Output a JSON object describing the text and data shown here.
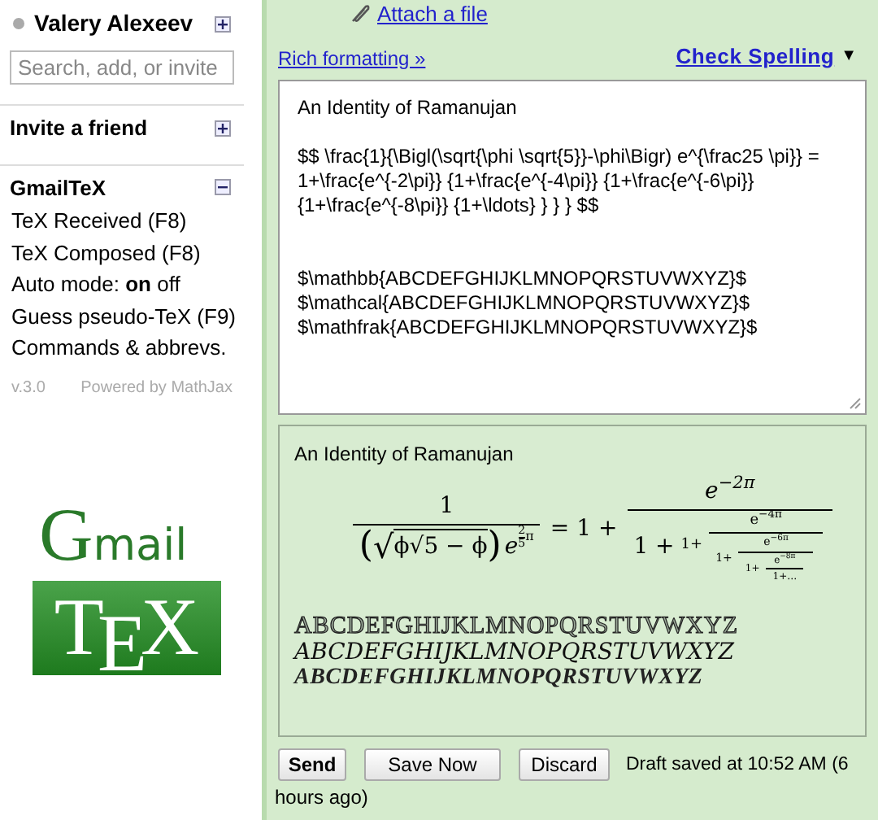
{
  "sidebar": {
    "contact": {
      "name": "Valery Alexeev",
      "online": false
    },
    "search": {
      "placeholder": "Search, add, or invite"
    },
    "sections": [
      {
        "title": "Invite a friend",
        "expanded": false
      },
      {
        "title": "GmailTeX",
        "expanded": true,
        "items": [
          "TeX Received (F8)",
          "TeX Composed (F8)",
          "Auto mode: **on** off",
          "Guess pseudo-TeX (F9)",
          "Commands & abbrevs."
        ]
      }
    ],
    "version": "v.3.0",
    "powered": "Powered by MathJax",
    "logo": {
      "top": "Gmail",
      "bottom": "TEX"
    }
  },
  "compose": {
    "attach": "Attach a file",
    "rich_formatting": "Rich formatting »",
    "check_spelling": "Check Spelling",
    "check_spelling_caret": "▼",
    "body_paragraphs": [
      [
        "An Identity of Ramanujan"
      ],
      [
        "$$ \\frac{1}{\\Bigl(\\sqrt{\\phi \\sqrt{5}}-\\phi\\Bigr) e^{\\frac25 \\pi}} =",
        "1+\\frac{e^{-2\\pi}} {1+\\frac{e^{-4\\pi}} {1+\\frac{e^{-6\\pi}}",
        "{1+\\frac{e^{-8\\pi}} {1+\\ldots} } } } $$"
      ],
      [
        "$\\mathbb{ABCDEFGHIJKLMNOPQRSTUVWXYZ}$",
        "$\\mathcal{ABCDEFGHIJKLMNOPQRSTUVWXYZ}$",
        "$\\mathfrak{ABCDEFGHIJKLMNOPQRSTUVWXYZ}$"
      ]
    ],
    "preview": {
      "title": "An Identity of Ramanujan",
      "formula": {
        "lhs_numerator": "1",
        "open": "(",
        "radical": "√",
        "radicand": "ϕ√5 − ϕ",
        "close": ")",
        "base": "e",
        "exp_numerator": "2",
        "exp_denominator": "5",
        "exp_rest": "π",
        "equals": "= 1 +",
        "levels": [
          {
            "numerator": "e$^{−2π}$",
            "prefix": "1 +"
          },
          {
            "numerator": "e$^{−4π}$",
            "prefix": "1+"
          },
          {
            "numerator": "e$^{−6π}$",
            "prefix": "1+"
          },
          {
            "numerator": "e$^{−8π}$",
            "prefix": "1+"
          }
        ],
        "tail": "1+…"
      },
      "alphabets": [
        {
          "kind": "outline",
          "text": "ABCDEFGHIJKLMNOPQRSTUVWXYZ"
        },
        {
          "kind": "script",
          "text": "ABCDEFGHIJKLMNOPQRSTUVWXYZ"
        },
        {
          "kind": "gothic",
          "text": "ABCDEFGHIJKLMNOPQRSTUVWXYZ"
        }
      ]
    },
    "buttons": [
      {
        "label": "Send",
        "primary": true
      },
      {
        "label": "Save Now",
        "primary": false
      },
      {
        "label": "Discard",
        "primary": false
      }
    ],
    "status_lines": [
      "Draft saved at 10:52 AM (6",
      "hours ago)"
    ]
  }
}
